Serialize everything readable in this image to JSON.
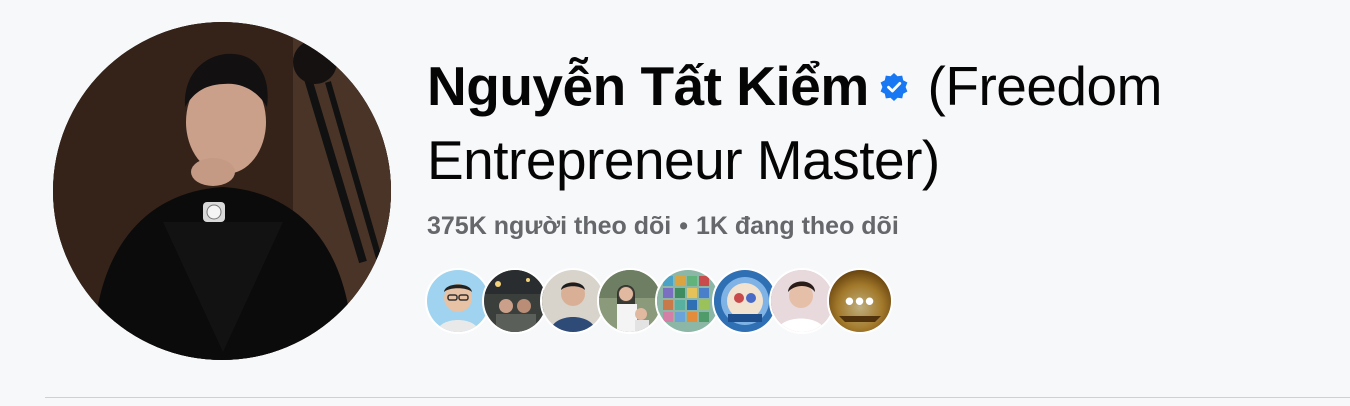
{
  "profile": {
    "name": "Nguyễn Tất Kiểm",
    "alternate_name": "(Freedom Entrepreneur Master)",
    "verified": true,
    "followers_text": "375K người theo dõi",
    "separator": "•",
    "following_text": "1K đang theo dõi"
  },
  "mutual_friends": {
    "more_label": "•••",
    "avatar_colors": [
      "#9fd3ef",
      "#3b3f3c",
      "#d8d4cc",
      "#8a9a7a",
      "#8cb6a6",
      "#2f6fb4",
      "#d9c6c6",
      "#c99628"
    ]
  },
  "colors": {
    "background": "#f7f8fa",
    "name_text": "#050505",
    "secondary_text": "#65676b",
    "verified_badge": "#1877f2",
    "divider": "#ced0d4"
  },
  "icons": {
    "verified": "verified-badge-icon",
    "more": "more-horizontal-icon"
  }
}
